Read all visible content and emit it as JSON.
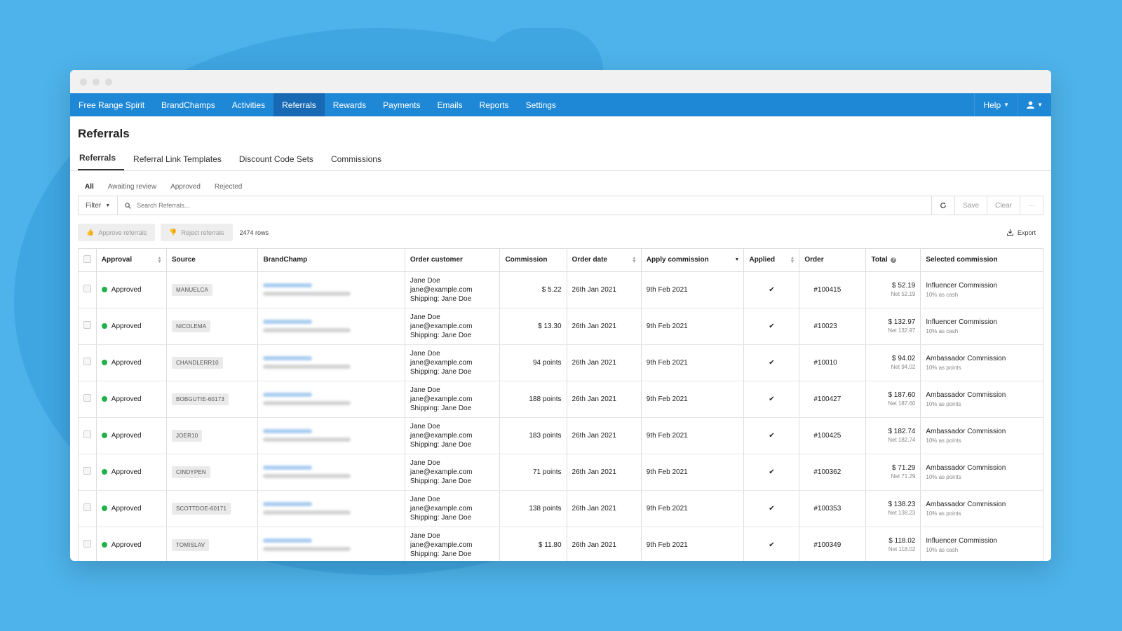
{
  "nav": {
    "items": [
      "Free Range Spirit",
      "BrandChamps",
      "Activities",
      "Referrals",
      "Rewards",
      "Payments",
      "Emails",
      "Reports",
      "Settings"
    ],
    "help": "Help"
  },
  "page": {
    "title": "Referrals"
  },
  "tabs": [
    "Referrals",
    "Referral Link Templates",
    "Discount Code Sets",
    "Commissions"
  ],
  "subfilters": [
    "All",
    "Awaiting review",
    "Approved",
    "Rejected"
  ],
  "search": {
    "filter_label": "Filter",
    "placeholder": "Search Referrals...",
    "save_label": "Save",
    "clear_label": "Clear",
    "more_label": "···"
  },
  "actions": {
    "approve_label": "Approve referrals",
    "reject_label": "Reject referrals",
    "row_count": "2474 rows",
    "export_label": "Export"
  },
  "table": {
    "headers": [
      "Approval",
      "Source",
      "BrandChamp",
      "Order customer",
      "Commission",
      "Order date",
      "Apply commission",
      "Applied",
      "Order",
      "Total",
      "Selected commission"
    ],
    "rows": [
      {
        "approval": "Approved",
        "source": "MANUELCA",
        "cust_name": "Jane Doe",
        "cust_email": "jane@example.com",
        "cust_ship": "Shipping: Jane Doe",
        "commission": "$ 5.22",
        "order_date": "26th Jan 2021",
        "apply": "9th Feb 2021",
        "applied": "✔",
        "order": "#100415",
        "total": "$ 52.19",
        "net": "Net 52.19",
        "sel": "Influencer Commission",
        "sel_sub": "10% as cash"
      },
      {
        "approval": "Approved",
        "source": "NICOLEMA",
        "cust_name": "Jane Doe",
        "cust_email": "jane@example.com",
        "cust_ship": "Shipping: Jane Doe",
        "commission": "$ 13.30",
        "order_date": "26th Jan 2021",
        "apply": "9th Feb 2021",
        "applied": "✔",
        "order": "#10023",
        "total": "$ 132.97",
        "net": "Net 132.97",
        "sel": "Influencer Commission",
        "sel_sub": "10% as cash"
      },
      {
        "approval": "Approved",
        "source": "CHANDLERR10",
        "cust_name": "Jane Doe",
        "cust_email": "jane@example.com",
        "cust_ship": "Shipping: Jane Doe",
        "commission": "94 points",
        "order_date": "26th Jan 2021",
        "apply": "9th Feb 2021",
        "applied": "✔",
        "order": "#10010",
        "total": "$ 94.02",
        "net": "Net 94.02",
        "sel": "Ambassador Commission",
        "sel_sub": "10% as points"
      },
      {
        "approval": "Approved",
        "source": "BOBGUTIE-60173",
        "cust_name": "Jane Doe",
        "cust_email": "jane@example.com",
        "cust_ship": "Shipping: Jane Doe",
        "commission": "188 points",
        "order_date": "26th Jan 2021",
        "apply": "9th Feb 2021",
        "applied": "✔",
        "order": "#100427",
        "total": "$ 187.60",
        "net": "Net 187.60",
        "sel": "Ambassador Commission",
        "sel_sub": "10% as points"
      },
      {
        "approval": "Approved",
        "source": "JOER10",
        "cust_name": "Jane Doe",
        "cust_email": "jane@example.com",
        "cust_ship": "Shipping: Jane Doe",
        "commission": "183 points",
        "order_date": "26th Jan 2021",
        "apply": "9th Feb 2021",
        "applied": "✔",
        "order": "#100425",
        "total": "$ 182.74",
        "net": "Net 182.74",
        "sel": "Ambassador Commission",
        "sel_sub": "10% as points"
      },
      {
        "approval": "Approved",
        "source": "CINDYPEN",
        "cust_name": "Jane Doe",
        "cust_email": "jane@example.com",
        "cust_ship": "Shipping: Jane Doe",
        "commission": "71 points",
        "order_date": "26th Jan 2021",
        "apply": "9th Feb 2021",
        "applied": "✔",
        "order": "#100362",
        "total": "$ 71.29",
        "net": "Net 71.29",
        "sel": "Ambassador Commission",
        "sel_sub": "10% as points"
      },
      {
        "approval": "Approved",
        "source": "SCOTTDOE-60171",
        "cust_name": "Jane Doe",
        "cust_email": "jane@example.com",
        "cust_ship": "Shipping: Jane Doe",
        "commission": "138 points",
        "order_date": "26th Jan 2021",
        "apply": "9th Feb 2021",
        "applied": "✔",
        "order": "#100353",
        "total": "$ 138.23",
        "net": "Net 138.23",
        "sel": "Ambassador Commission",
        "sel_sub": "10% as points"
      },
      {
        "approval": "Approved",
        "source": "TOMISLAV",
        "cust_name": "Jane Doe",
        "cust_email": "jane@example.com",
        "cust_ship": "Shipping: Jane Doe",
        "commission": "$ 11.80",
        "order_date": "26th Jan 2021",
        "apply": "9th Feb 2021",
        "applied": "✔",
        "order": "#100349",
        "total": "$ 118.02",
        "net": "Net 118.02",
        "sel": "Influencer Commission",
        "sel_sub": "10% as cash"
      }
    ]
  },
  "colors": {
    "background": "#4db3ea",
    "navbar": "#1e88d6",
    "nav_active": "#1769b4",
    "approved_dot": "#21b14a"
  }
}
